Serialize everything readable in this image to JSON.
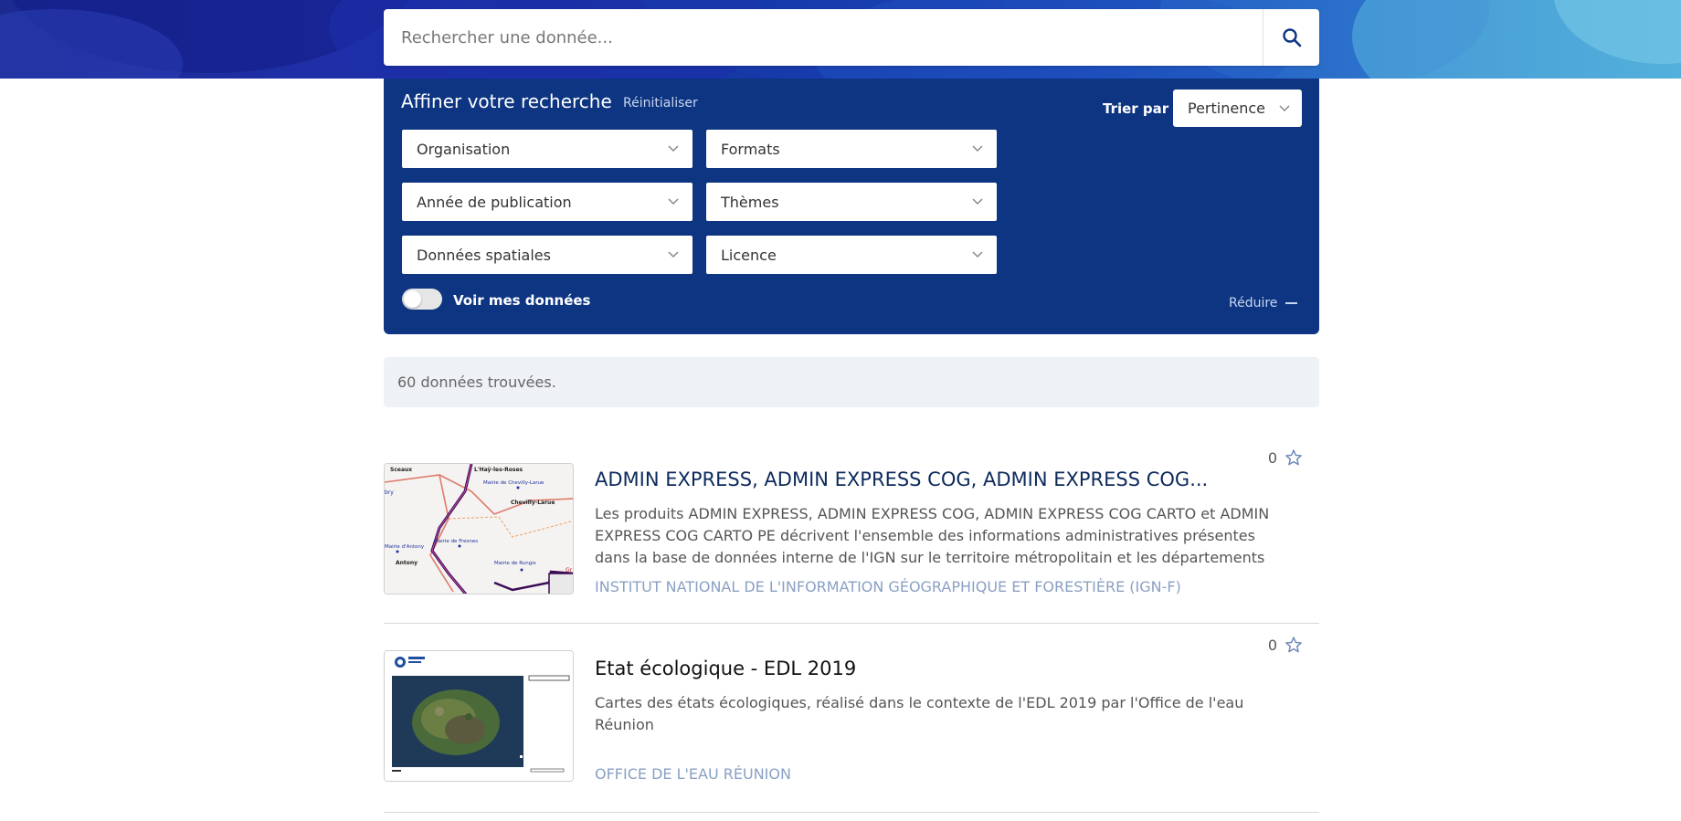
{
  "search": {
    "placeholder": "Rechercher une donnée...",
    "icon": "search-icon"
  },
  "filters": {
    "title": "Affiner votre recherche",
    "reset_label": "Réinitialiser",
    "sort_label": "Trier par :",
    "sort_value": "Pertinence",
    "dropdowns": [
      "Organisation",
      "Formats",
      "Année de publication",
      "Thèmes",
      "Données spatiales",
      "Licence"
    ],
    "toggle_label": "Voir mes données",
    "toggle_on": false,
    "reduce_label": "Réduire"
  },
  "results": {
    "count_text": "60 données trouvées."
  },
  "cards": [
    {
      "title": "ADMIN EXPRESS, ADMIN EXPRESS COG, ADMIN EXPRESS COG...",
      "description": "Les produits ADMIN EXPRESS, ADMIN EXPRESS COG, ADMIN EXPRESS COG CARTO et ADMIN EXPRESS COG CARTO PE décrivent l'ensemble des informations administratives présentes dans la base de données interne de l'IGN sur le territoire métropolitain et les départements d'outre-m...",
      "organization": "INSTITUT NATIONAL DE L'INFORMATION GÉOGRAPHIQUE ET FORESTIÈRE (IGN-F)",
      "favorites": "0",
      "thumb_labels": {
        "sceaux": "Sceaux",
        "hay": "L'Haÿ-les-Roses",
        "mairie_chevilly": "Mairie de Chevilly-Larue",
        "chevilly": "Chevilly-Larue",
        "mairie_antony": "Mairie d'Antony",
        "mairie_fresnes": "Mairie de Fresnes",
        "mairie_rungis": "Mairie de Rungis",
        "antony": "Antony",
        "bry": "bry",
        "gr": "Gr"
      }
    },
    {
      "title": "Etat écologique - EDL 2019",
      "description": "Cartes des états écologiques, réalisé dans le contexte de l'EDL 2019 par l'Office de l'eau Réunion",
      "organization": "OFFICE DE L'EAU RÉUNION",
      "favorites": "0"
    }
  ],
  "colors": {
    "panel": "#0d3582",
    "title_link": "#0d2a5c",
    "org_link": "#8aa0c4"
  }
}
